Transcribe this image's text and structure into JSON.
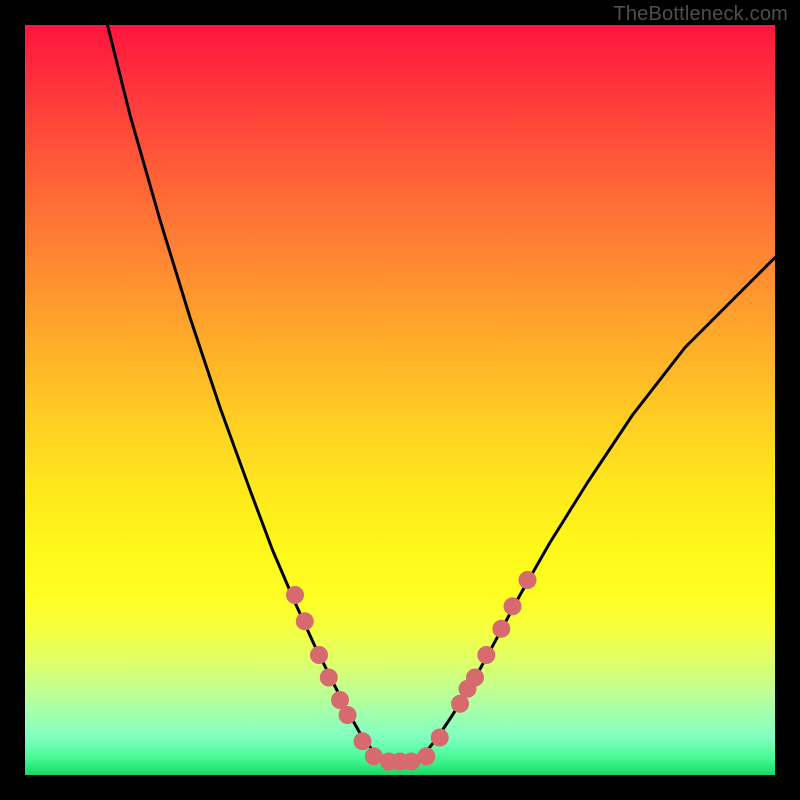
{
  "attribution": "TheBottleneck.com",
  "chart_data": {
    "type": "line",
    "title": "",
    "xlabel": "",
    "ylabel": "",
    "xlim": [
      0,
      100
    ],
    "ylim": [
      0,
      100
    ],
    "grid": false,
    "legend": false,
    "notes": "V-shaped bottleneck curve over a red→green vertical gradient. Axes are unlabeled. x/y are percentages of the plot area. Salmon dots mark discrete sample points along the curve near the minimum.",
    "series": [
      {
        "name": "bottleneck-curve",
        "x": [
          11,
          14,
          18,
          22,
          26,
          30,
          33,
          36,
          38.5,
          41,
          43,
          45,
          47,
          53,
          55,
          57,
          59.5,
          62.5,
          66,
          70,
          75,
          81,
          88,
          96,
          100
        ],
        "y": [
          100,
          88,
          74,
          61,
          49,
          38,
          30,
          23,
          17.5,
          12.5,
          8.5,
          5,
          2.5,
          2.5,
          5,
          8,
          12,
          17.5,
          24,
          31,
          39,
          48,
          57,
          65,
          69
        ]
      }
    ],
    "markers": {
      "name": "sample-dots",
      "color": "#d66a6e",
      "radius_px": 9,
      "points": [
        {
          "x": 36.0,
          "y": 24.0
        },
        {
          "x": 37.3,
          "y": 20.5
        },
        {
          "x": 39.2,
          "y": 16.0
        },
        {
          "x": 40.5,
          "y": 13.0
        },
        {
          "x": 42.0,
          "y": 10.0
        },
        {
          "x": 43.0,
          "y": 8.0
        },
        {
          "x": 45.0,
          "y": 4.5
        },
        {
          "x": 46.5,
          "y": 2.5
        },
        {
          "x": 48.5,
          "y": 1.8
        },
        {
          "x": 50.0,
          "y": 1.8
        },
        {
          "x": 51.5,
          "y": 1.8
        },
        {
          "x": 53.5,
          "y": 2.5
        },
        {
          "x": 55.3,
          "y": 5.0
        },
        {
          "x": 58.0,
          "y": 9.5
        },
        {
          "x": 59.0,
          "y": 11.5
        },
        {
          "x": 60.0,
          "y": 13.0
        },
        {
          "x": 61.5,
          "y": 16.0
        },
        {
          "x": 63.5,
          "y": 19.5
        },
        {
          "x": 65.0,
          "y": 22.5
        },
        {
          "x": 67.0,
          "y": 26.0
        }
      ]
    }
  }
}
